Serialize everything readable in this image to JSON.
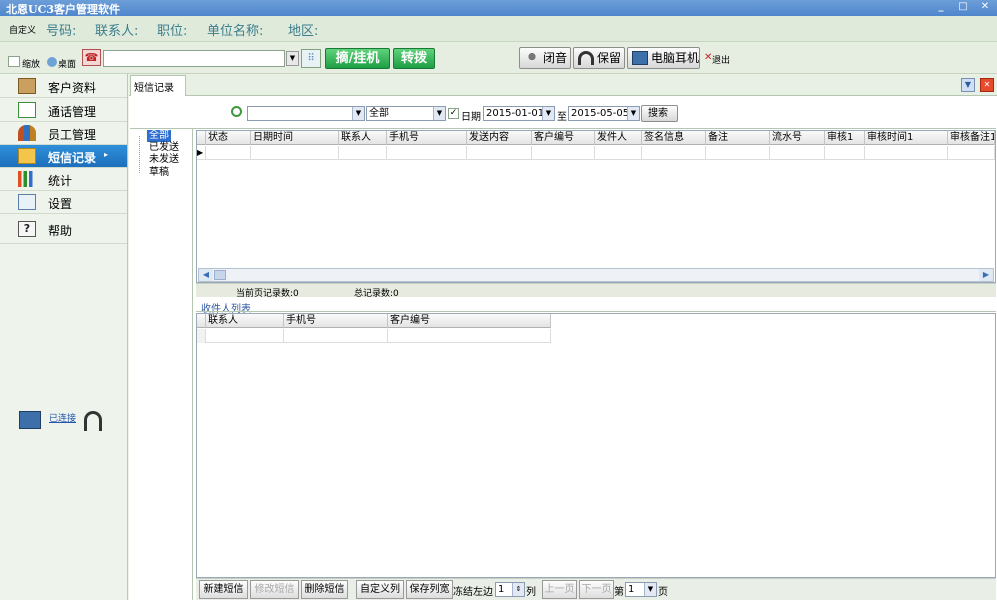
{
  "window": {
    "title": "北恩UC3客户管理软件"
  },
  "infobar": {
    "custom_label": "自定义",
    "fields": [
      "号码:",
      "联系人:",
      "职位:",
      "单位名称:",
      "地区:"
    ]
  },
  "toolbar": {
    "shrink_label": "缩放",
    "desktop_label": "桌面",
    "dial_value": "",
    "pickup_label": "摘/挂机",
    "transfer_label": "转拨",
    "mute_label": "闭音",
    "hold_label": "保留",
    "pc_headset_label": "电脑耳机",
    "exit_label": "退出"
  },
  "sidebar": {
    "items": [
      {
        "label": "客户资料",
        "icon": "customer-icon"
      },
      {
        "label": "通话管理",
        "icon": "call-icon"
      },
      {
        "label": "员工管理",
        "icon": "staff-icon"
      },
      {
        "label": "短信记录",
        "icon": "sms-icon",
        "active": true
      },
      {
        "label": "统计",
        "icon": "chart-icon"
      },
      {
        "label": "设置",
        "icon": "settings-icon"
      },
      {
        "label": "帮助",
        "icon": "help-icon"
      }
    ],
    "connection_status": "已连接"
  },
  "tab": {
    "label": "短信记录"
  },
  "search": {
    "field_value": "",
    "status_value": "全部",
    "date_label": "日期",
    "date_checked": true,
    "date_from": "2015-01-01",
    "date_to_label": "至",
    "date_to": "2015-05-05",
    "search_button": "搜索"
  },
  "tree": {
    "items": [
      "全部",
      "已发送",
      "未发送",
      "草稿"
    ],
    "selected": 0
  },
  "sms_grid": {
    "columns": [
      "状态",
      "日期时间",
      "联系人",
      "手机号",
      "发送内容",
      "客户编号",
      "发件人",
      "签名信息",
      "备注",
      "流水号",
      "审核1",
      "审核时间1",
      "审核备注1"
    ]
  },
  "status": {
    "page_records": "当前页记录数:0",
    "total_records": "总记录数:0"
  },
  "recipients": {
    "title": "收件人列表",
    "columns": [
      "联系人",
      "手机号",
      "客户编号"
    ]
  },
  "bottom": {
    "new_sms": "新建短信",
    "edit_sms": "修改短信",
    "delete_sms": "删除短信",
    "custom_columns": "自定义列",
    "save_width": "保存列宽",
    "freeze_left": "冻结左边",
    "freeze_value": "1",
    "column_unit": "列",
    "prev_page": "上一页",
    "next_page": "下一页",
    "page_prefix": "第",
    "page_value": "1",
    "page_suffix": "页"
  }
}
